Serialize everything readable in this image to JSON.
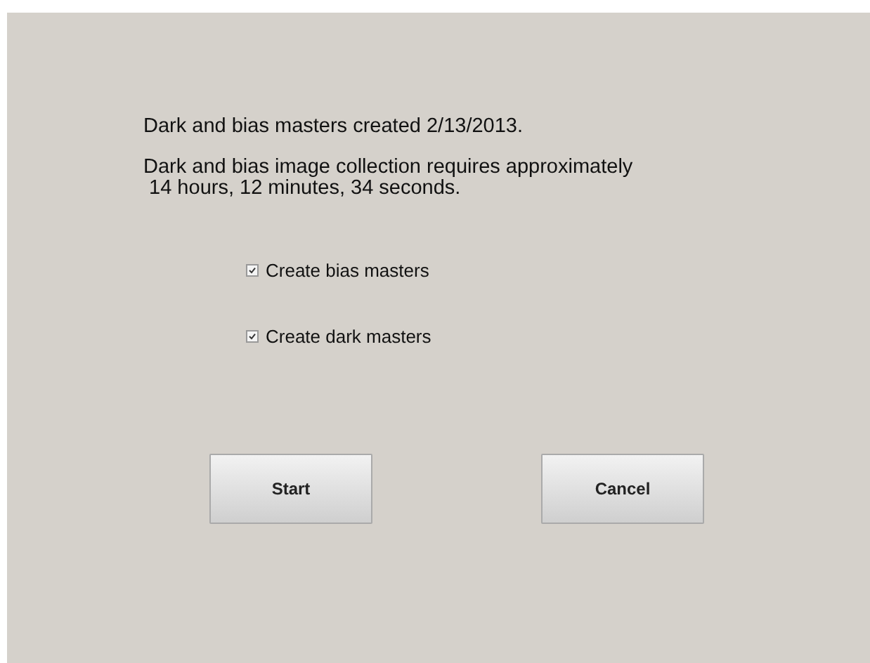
{
  "messages": [
    "Dark and bias masters created 2/13/2013.",
    "Dark and bias image collection requires approximately\n 14 hours, 12 minutes, 34 seconds."
  ],
  "options": [
    {
      "label": "Create bias masters",
      "checked": true
    },
    {
      "label": "Create dark masters",
      "checked": true
    }
  ],
  "buttons": [
    "Start",
    "Cancel"
  ]
}
